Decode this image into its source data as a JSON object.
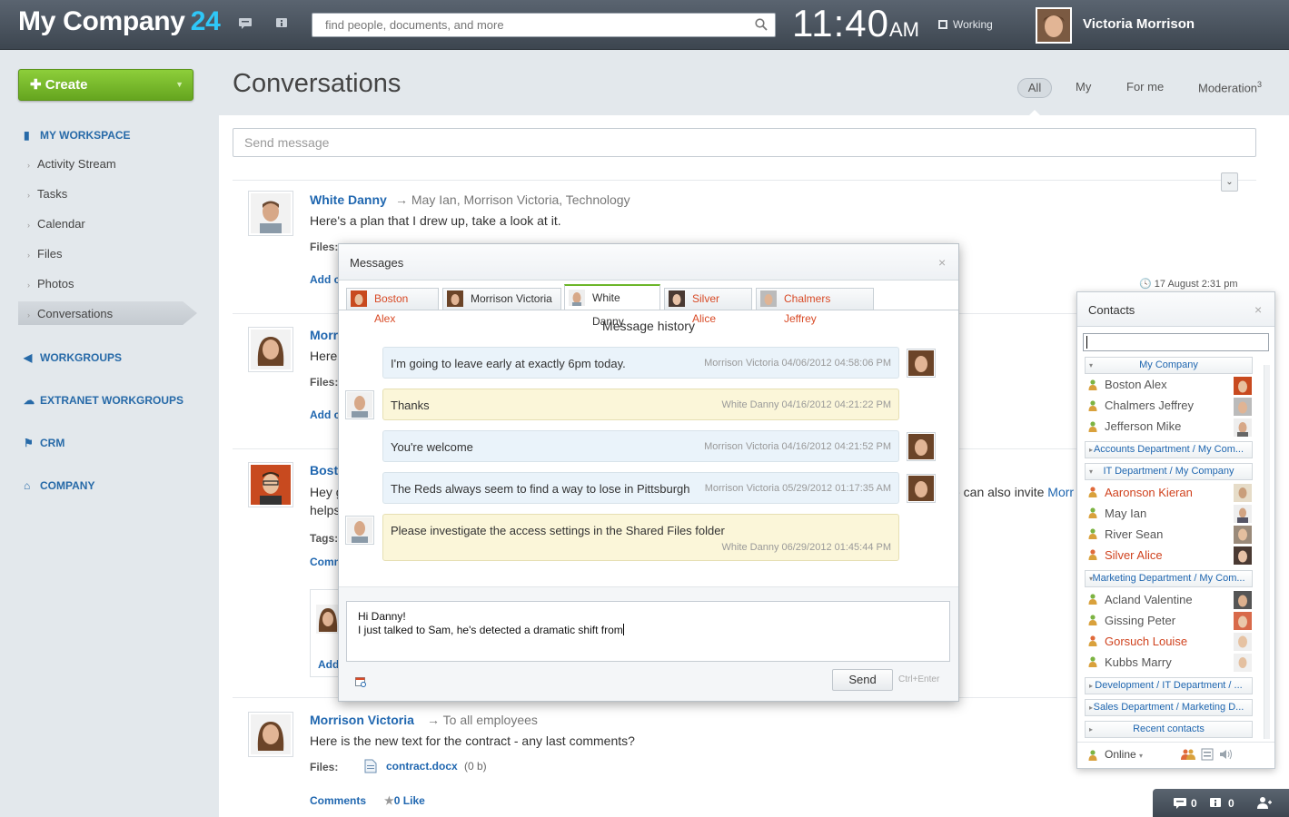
{
  "topbar": {
    "logo_text": "My Company",
    "logo_num": "24",
    "search_placeholder": "find people, documents, and more",
    "time": "11:40",
    "ampm": "AM",
    "status": "Working",
    "user_name": "Victoria Morrison"
  },
  "sidebar": {
    "create_label": "Create",
    "my_workspace": "MY WORKSPACE",
    "items": [
      "Activity Stream",
      "Tasks",
      "Calendar",
      "Files",
      "Photos",
      "Conversations"
    ],
    "workgroups": "WORKGROUPS",
    "extranet": "EXTRANET WORKGROUPS",
    "crm": "CRM",
    "company": "COMPANY"
  },
  "main": {
    "title": "Conversations",
    "filters": {
      "all": "All",
      "my": "My",
      "forme": "For me",
      "moderation": "Moderation",
      "moderation_count": "3"
    },
    "send_placeholder": "Send message",
    "posts": [
      {
        "author": "White Danny",
        "to": "May Ian, Morrison Victoria, Technology",
        "text": "Here's a plan that I drew up, take a look at it.",
        "files_label": "Files:",
        "add": "Add c",
        "date": "17 August 2:31 pm"
      },
      {
        "author": "Morr",
        "text": "Here",
        "files_label": "Files:",
        "add": "Add c"
      },
      {
        "author": "Bost",
        "text1": "Hey g",
        "text2": "helps",
        "tags_label": "Tags:",
        "comments": "Comm",
        "tail_text": "e can also invite",
        "tail_link": "Morr",
        "add": "Add"
      },
      {
        "author": "Morrison Victoria",
        "to": "To all employees",
        "text": "Here is the new text for the contract - any last comments?",
        "files_label": "Files:",
        "file_name": "contract.docx",
        "file_size": "(0 b)",
        "comments_label": "Comments",
        "like_count": "0",
        "like_label": "Like"
      }
    ]
  },
  "messages": {
    "title": "Messages",
    "tabs": [
      "Boston Alex",
      "Morrison Victoria",
      "White Danny",
      "Silver Alice",
      "Chalmers Jeffrey"
    ],
    "history_title": "Message history",
    "items": [
      {
        "text": "I'm going to leave early at exactly 6pm today.",
        "meta": "Morrison Victoria   04/06/2012 04:58:06 PM"
      },
      {
        "text": "Thanks",
        "meta": "White Danny   04/16/2012 04:21:22 PM"
      },
      {
        "text": "You're welcome",
        "meta": "Morrison Victoria   04/16/2012 04:21:52 PM"
      },
      {
        "text": "The Reds always seem to find a way to lose in Pittsburgh",
        "meta": "Morrison Victoria   05/29/2012 01:17:35 AM"
      },
      {
        "text": "Please investigate the access settings in the Shared Files folder",
        "meta": "White Danny   06/29/2012 01:45:44 PM"
      }
    ],
    "compose_line1": "Hi Danny!",
    "compose_line2": "I just talked to Sam, he's detected a dramatic shift from",
    "send_label": "Send",
    "shortcut": "Ctrl+Enter"
  },
  "contacts": {
    "title": "Contacts",
    "groups": {
      "g1": "My Company",
      "g2": "Accounts Department / My Com...",
      "g3": "IT Department / My Company",
      "g4": "Marketing Department / My Com...",
      "g5": "Development / IT Department / ...",
      "g6": "Sales Department / Marketing D...",
      "g7": "Recent contacts"
    },
    "names": [
      "Boston Alex",
      "Chalmers Jeffrey",
      "Jefferson Mike",
      "Aaronson Kieran",
      "May Ian",
      "River Sean",
      "Silver Alice",
      "Acland Valentine",
      "Gissing Peter",
      "Gorsuch Louise",
      "Kubbs Marry"
    ],
    "online_label": "Online"
  },
  "bottombar": {
    "messages_count": "0",
    "notify_count": "0"
  },
  "colors": {
    "accent": "#2067b0",
    "brand_num": "#2fc7f7",
    "create_green": "#7bbd2f",
    "offline_red": "#d0431f"
  }
}
